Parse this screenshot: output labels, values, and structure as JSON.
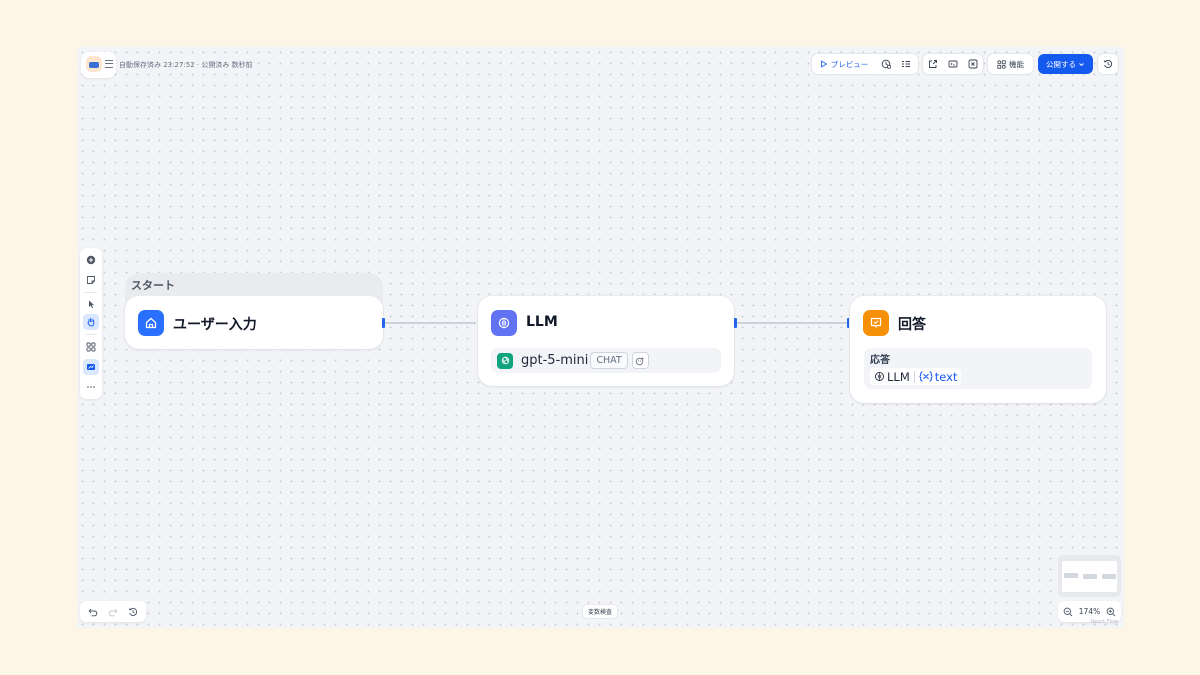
{
  "header": {
    "status": "自動保存済み 23:27:52 · 公開済み 数秒前"
  },
  "toolbar": {
    "preview_label": "プレビュー",
    "features_label": "機能",
    "publish_label": "公開する"
  },
  "nodes": {
    "start": {
      "group_label": "スタート",
      "title": "ユーザー入力",
      "color": "#2970ff"
    },
    "llm": {
      "title": "LLM",
      "model": "gpt-5-mini",
      "mode_badge": "CHAT",
      "color": "#6172f3"
    },
    "answer": {
      "title": "回答",
      "field_label": "応答",
      "variable_source": "LLM",
      "variable_name": "text",
      "color": "#f79009"
    }
  },
  "bottom": {
    "variable_inspect_label": "変数検査",
    "zoom": "174%",
    "attribution": "React Flow"
  },
  "colors": {
    "accent": "#155aef",
    "canvas": "#f2f4f7",
    "page": "#fdf6e6"
  }
}
